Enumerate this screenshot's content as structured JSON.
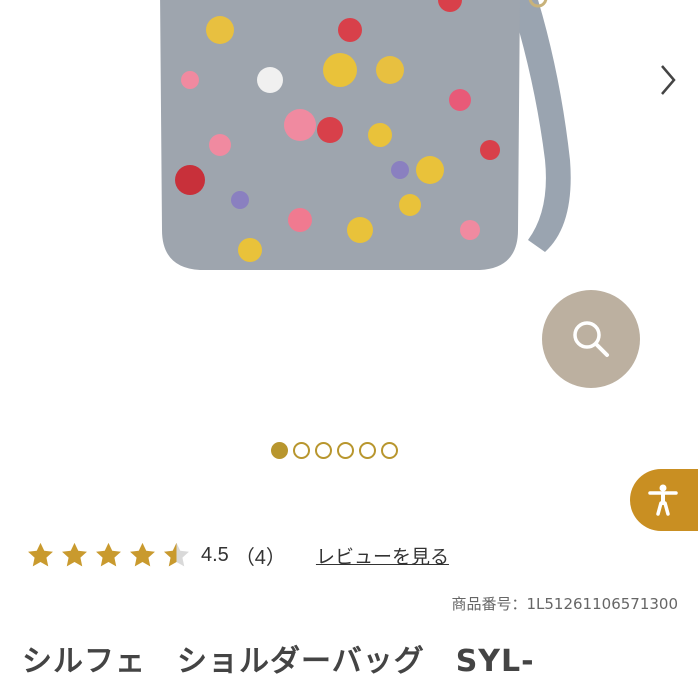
{
  "gallery": {
    "image_alt": "シルフェ ショルダーバッグ",
    "dots": [
      {
        "active": true
      },
      {
        "active": false
      },
      {
        "active": false
      },
      {
        "active": false
      },
      {
        "active": false
      },
      {
        "active": false
      }
    ],
    "next_icon": "chevron-right-icon",
    "zoom_icon": "magnifier-icon"
  },
  "accessibility": {
    "icon": "accessibility-person-icon",
    "color": "#c98f22"
  },
  "rating": {
    "stars_value": 4.5,
    "stars_max": 5,
    "value_text": "4.5",
    "count_text": "（4）",
    "review_link": "レビューを見る",
    "star_color": "#c99a2e"
  },
  "product": {
    "code_label": "商品番号：1L51261106571300",
    "title": "シルフェ　ショルダーバッグ　SYL-"
  },
  "colors": {
    "accent": "#b8962e",
    "zoom_bg": "#bcb0a0"
  }
}
